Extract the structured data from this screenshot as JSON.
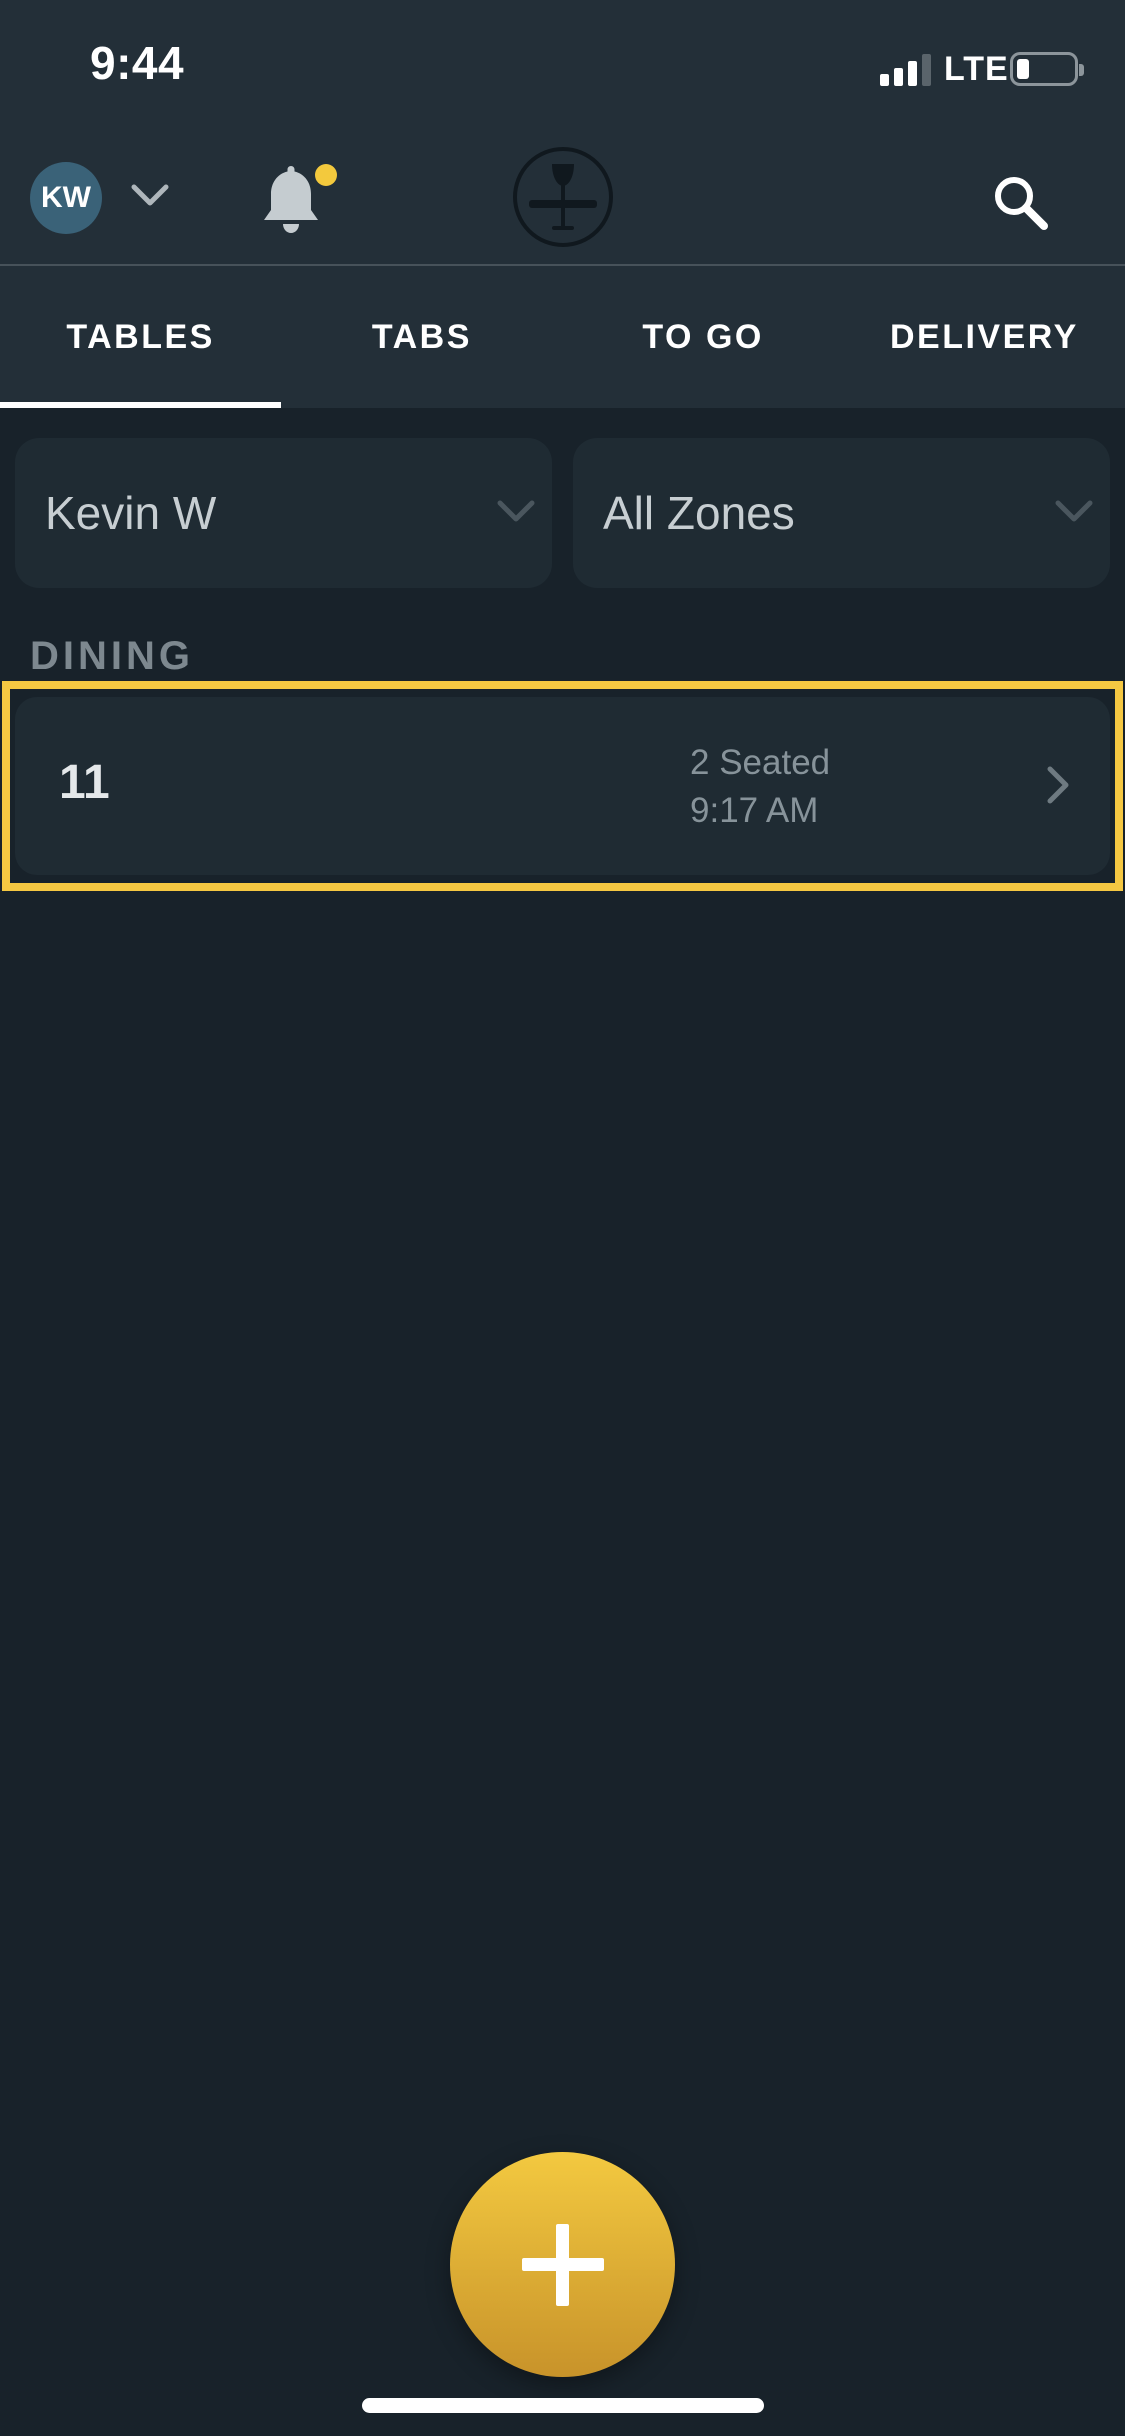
{
  "status_bar": {
    "time": "9:44",
    "network": "LTE"
  },
  "header": {
    "avatar_initials": "KW",
    "notification_dot_color": "#f3c93d"
  },
  "tabs": [
    {
      "label": "TABLES",
      "active": true
    },
    {
      "label": "TABS",
      "active": false
    },
    {
      "label": "TO GO",
      "active": false
    },
    {
      "label": "DELIVERY",
      "active": false
    }
  ],
  "filters": {
    "server": "Kevin W",
    "zone": "All Zones"
  },
  "section": {
    "title": "DINING"
  },
  "tables": [
    {
      "number": "11",
      "seated": "2 Seated",
      "time": "9:17 AM"
    }
  ],
  "colors": {
    "accent": "#f3c940",
    "highlight": "#f5c842",
    "background": "#18222a",
    "header": "#232f38"
  },
  "icons": {
    "dropdown": "chevron-down-icon",
    "notifications": "bell-icon",
    "logo": "restaurant-logo-icon",
    "search": "search-icon",
    "row": "chevron-right-icon",
    "add": "plus-icon"
  }
}
